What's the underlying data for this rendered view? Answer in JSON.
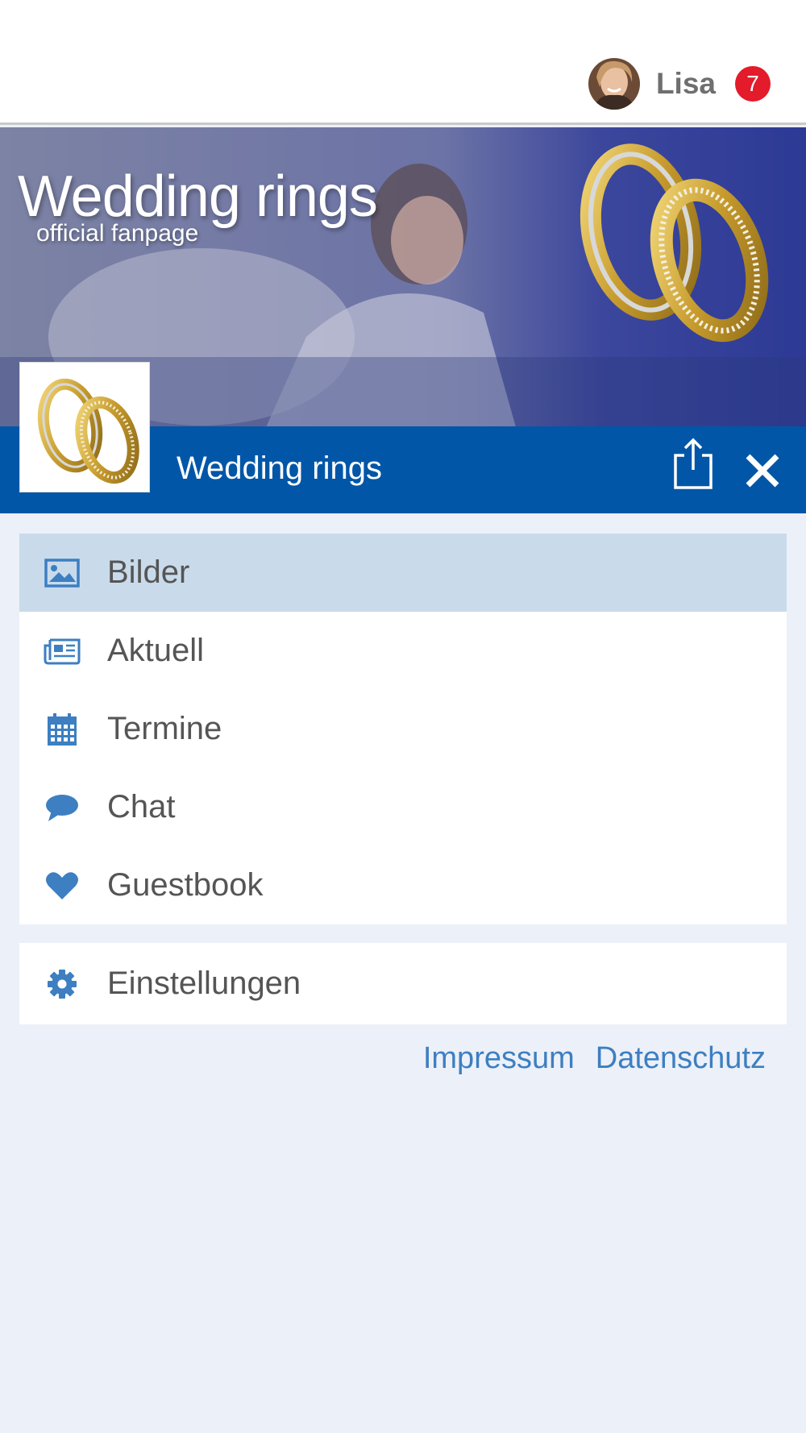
{
  "header": {
    "user_name": "Lisa",
    "notification_count": "7"
  },
  "banner": {
    "title": "Wedding rings",
    "subtitle": "official fanpage"
  },
  "page": {
    "name": "Wedding rings"
  },
  "menu": {
    "items": [
      {
        "label": "Bilder",
        "icon": "image-icon",
        "active": true
      },
      {
        "label": "Aktuell",
        "icon": "newspaper-icon",
        "active": false
      },
      {
        "label": "Termine",
        "icon": "calendar-icon",
        "active": false
      },
      {
        "label": "Chat",
        "icon": "chat-bubble-icon",
        "active": false
      },
      {
        "label": "Guestbook",
        "icon": "heart-icon",
        "active": false
      }
    ],
    "settings_label": "Einstellungen"
  },
  "footer": {
    "impressum": "Impressum",
    "datenschutz": "Datenschutz"
  },
  "colors": {
    "brand_blue": "#0256a7",
    "icon_blue": "#3d7fc1",
    "active_bg": "#c9dbeb",
    "badge_red": "#e31b2a",
    "page_bg": "#ecf0f8"
  }
}
